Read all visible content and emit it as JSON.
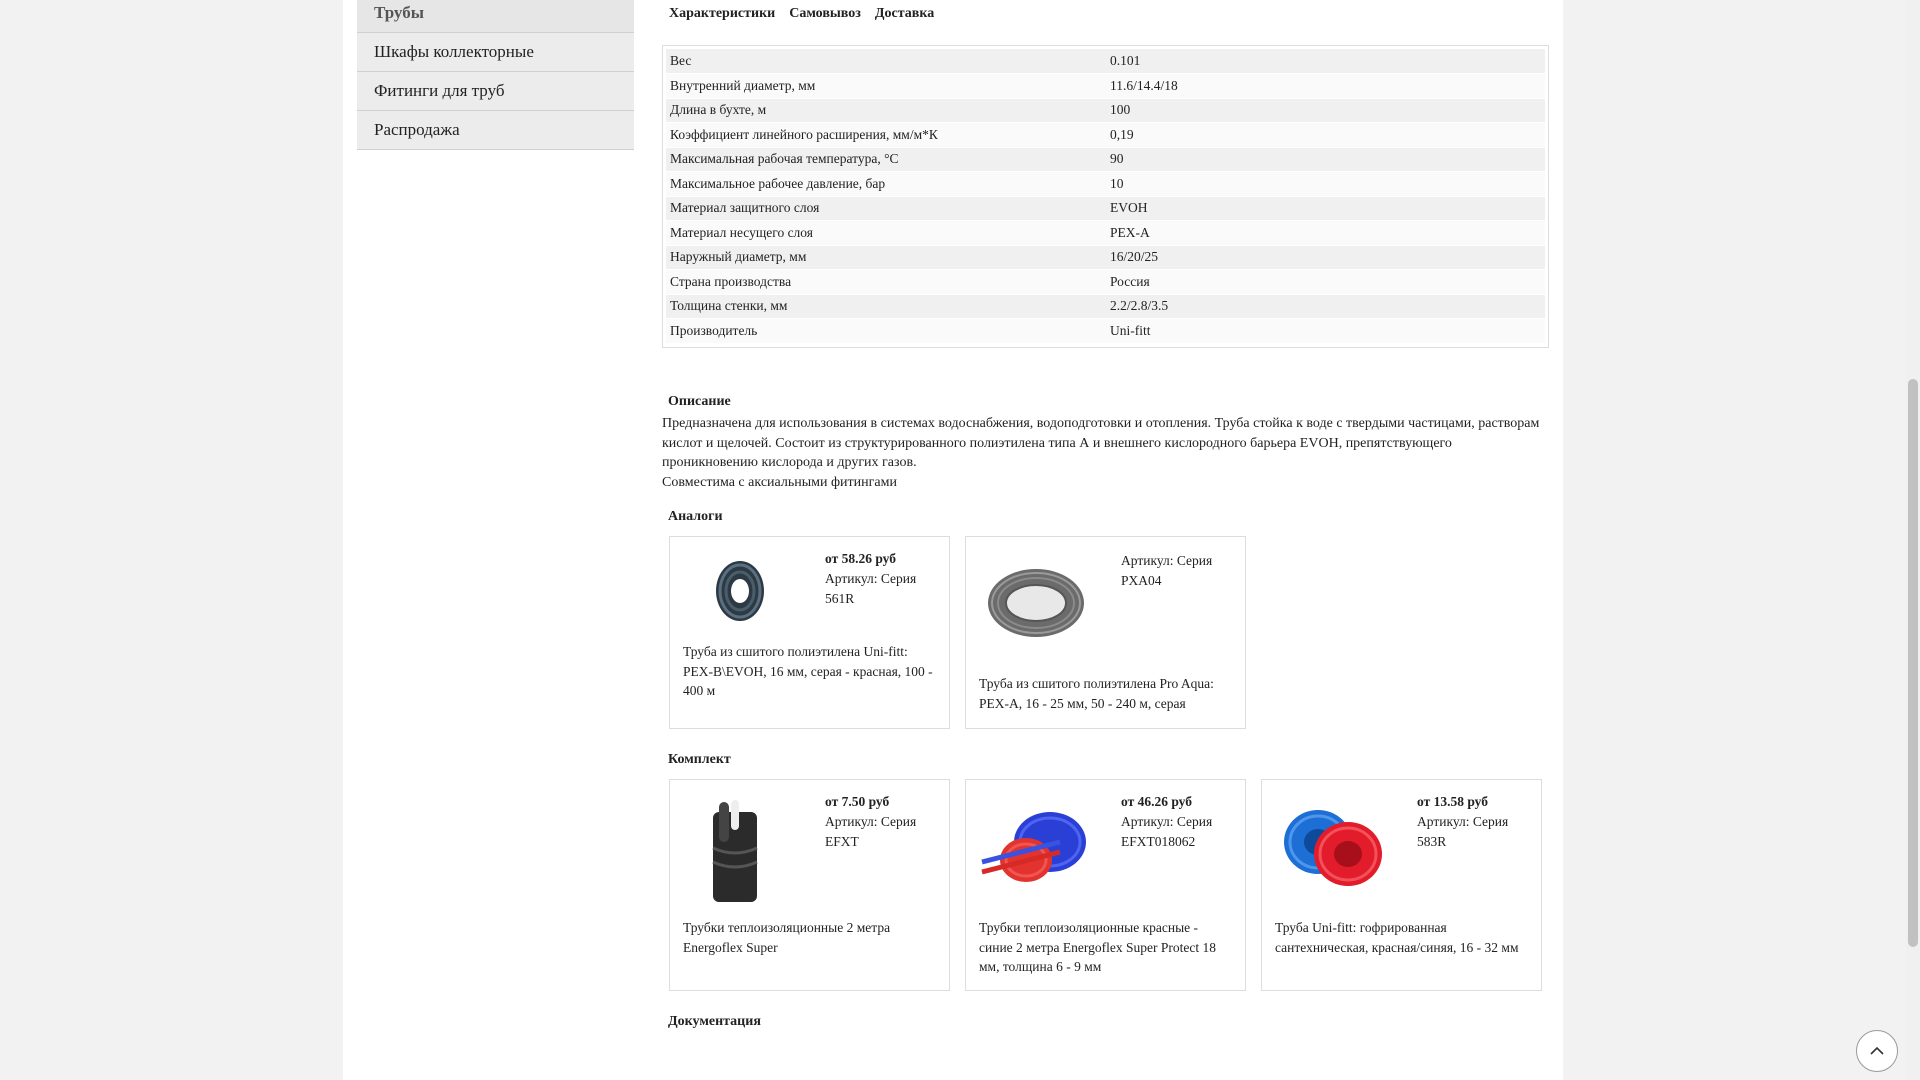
{
  "sidebar": {
    "items": [
      {
        "label": "Трубы"
      },
      {
        "label": "Шкафы коллекторные"
      },
      {
        "label": "Фитинги для труб"
      },
      {
        "label": "Распродажа"
      }
    ]
  },
  "tabs": [
    "Характеристики",
    "Самовывоз",
    "Доставка"
  ],
  "specs": [
    {
      "k": "Вес",
      "v": "0.101"
    },
    {
      "k": "Внутренний диаметр, мм",
      "v": "11.6/14.4/18"
    },
    {
      "k": "Длина в бухте, м",
      "v": "100"
    },
    {
      "k": "Коэффициент линейного расширения, мм/м*К",
      "v": "0,19"
    },
    {
      "k": "Максимальная рабочая температура, °С",
      "v": "90"
    },
    {
      "k": "Максимальное рабочее давление, бар",
      "v": "10"
    },
    {
      "k": "Материал защитного слоя",
      "v": "EVOH"
    },
    {
      "k": "Материал несущего слоя",
      "v": "PEX-A"
    },
    {
      "k": "Наружный диаметр, мм",
      "v": "16/20/25"
    },
    {
      "k": "Страна производства",
      "v": "Россия"
    },
    {
      "k": "Толщина стенки, мм",
      "v": "2.2/2.8/3.5"
    },
    {
      "k": "Производитель",
      "v": "Uni-fitt"
    }
  ],
  "description": {
    "heading": "Описание",
    "text": "Предназначена для использования в системах водоснабжения, водоподготовки и отопления. Труба стойка к воде с твердыми частицами, растворам кислот и щелочей. Состоит из структурированного полиэтилена типа А и внешнего кислородного барьера EVOH, препятствующего проникновению кислорода и других газов.",
    "text2": "Совместима с аксиальными фитингами"
  },
  "analogs": {
    "heading": "Аналоги",
    "items": [
      {
        "price": "от 58.26 руб",
        "article": "Артикул:  Серия 561R",
        "title": "Труба из сшитого полиэтилена Uni-fitt: PEX-B\\EVOH, 16 мм, серая - красная, 100 - 400 м"
      },
      {
        "price": "",
        "article": "Артикул:  Серия PXA04",
        "title": "Труба из сшитого полиэтилена Pro Aqua: PEX-A, 16 - 25 мм, 50 - 240 м, серая"
      }
    ]
  },
  "kit": {
    "heading": "Комплект",
    "items": [
      {
        "price": "от 7.50 руб",
        "article": "Артикул:  Серия EFXT",
        "title": "Трубки теплоизоляционные 2 метра Energoflex Super"
      },
      {
        "price": "от 46.26 руб",
        "article": "Артикул:  Серия EFXT018062",
        "title": "Трубки теплоизоляционные красные - синие 2 метра Energoflex Super Protect 18 мм, толщина 6 - 9 мм"
      },
      {
        "price": "от 13.58 руб",
        "article": "Артикул:  Серия 583R",
        "title": "Труба Uni-fitt: гофрированная сантехническая, красная/синяя, 16 - 32 мм"
      }
    ]
  },
  "docs": {
    "heading": "Документация"
  },
  "icons": {
    "scroll_top": "chevron-up-icon"
  }
}
